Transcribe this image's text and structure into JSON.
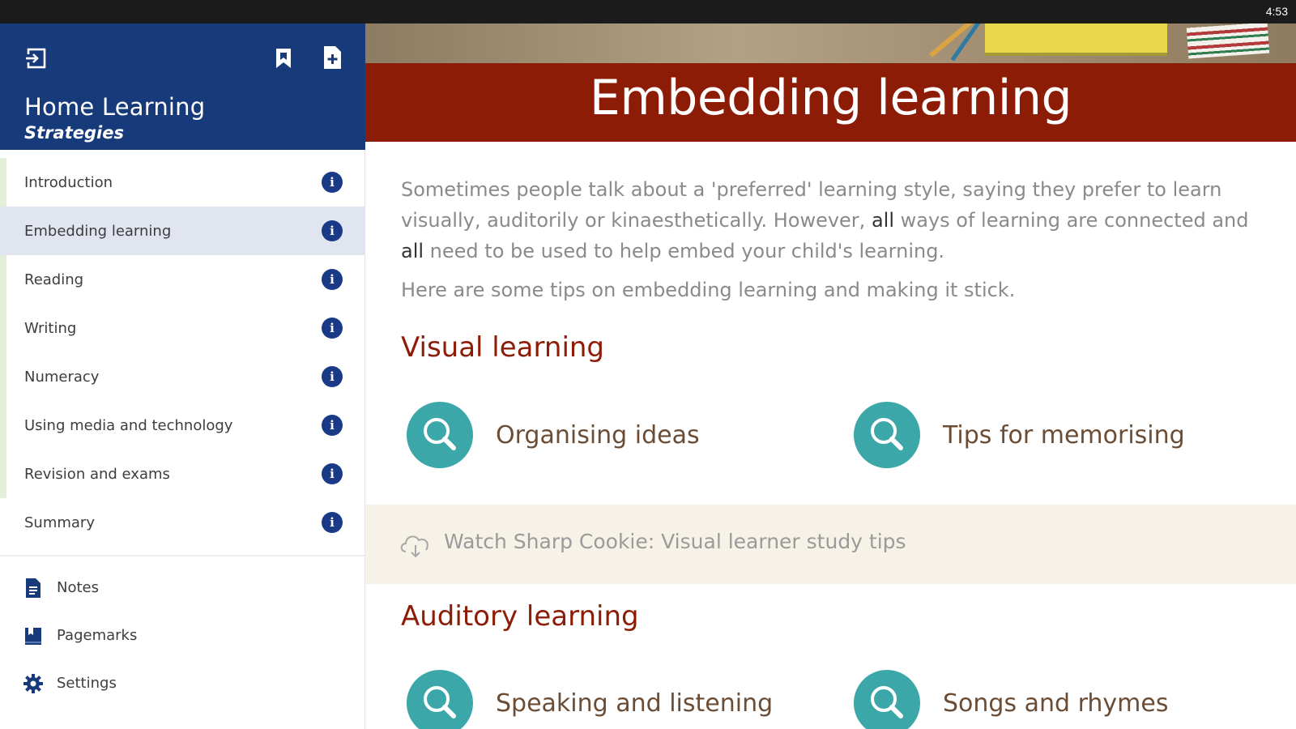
{
  "statusbar": {
    "time": "4:53"
  },
  "sidebar": {
    "title": "Home Learning",
    "subtitle": "Strategies",
    "icons": {
      "exit": "exit-icon",
      "bookmark": "bookmark-icon",
      "add_note": "add-note-icon"
    },
    "items": [
      {
        "label": "Introduction"
      },
      {
        "label": "Embedding learning"
      },
      {
        "label": "Reading"
      },
      {
        "label": "Writing"
      },
      {
        "label": "Numeracy"
      },
      {
        "label": "Using media and technology"
      },
      {
        "label": "Revision and exams"
      },
      {
        "label": "Summary"
      }
    ],
    "active_index": 1,
    "info_glyph": "i",
    "utilities": [
      {
        "label": "Notes",
        "icon": "notes-icon"
      },
      {
        "label": "Pagemarks",
        "icon": "pagemarks-icon"
      },
      {
        "label": "Settings",
        "icon": "gear-icon"
      }
    ]
  },
  "main": {
    "title": "Embedding learning",
    "intro_part1": "Sometimes people talk about a 'preferred' learning style, saying they prefer to learn visually, auditorily or kinaesthetically. However, ",
    "intro_bold1": "all",
    "intro_part2": " ways of learning are connected and ",
    "intro_bold2": "all",
    "intro_part3": " need to be used to help embed your child's learning.",
    "intro2": "Here are some tips on embedding learning and making it stick.",
    "visual": {
      "heading": "Visual learning",
      "tiles": [
        {
          "label": "Organising ideas"
        },
        {
          "label": "Tips for memorising"
        }
      ]
    },
    "watch": {
      "label": "Watch Sharp Cookie: Visual learner study tips",
      "icon": "cloud-icon"
    },
    "auditory": {
      "heading": "Auditory learning",
      "tiles": [
        {
          "label": "Speaking and listening"
        },
        {
          "label": "Songs and rhymes"
        }
      ]
    }
  },
  "colors": {
    "sidebar_header": "#173a7a",
    "title_bar": "#8c1c06",
    "teal": "#3ba7a8",
    "info_badge": "#1a3a88"
  }
}
